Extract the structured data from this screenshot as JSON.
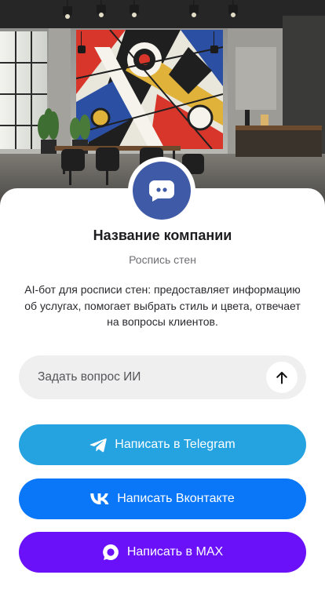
{
  "hero": {
    "icon": "office-mural-photo"
  },
  "profile": {
    "avatar_icon": "chat-bubble-icon",
    "avatar_color": "#3f5aa6",
    "title": "Название компании",
    "subtitle": "Роспись стен",
    "description": "AI-бот для росписи стен: предоставляет информацию об услугах, помогает выбрать стиль и цвета, отвечает на вопросы клиентов."
  },
  "ask": {
    "placeholder": "Задать вопрос ИИ",
    "value": "",
    "send_icon": "arrow-up-icon"
  },
  "buttons": {
    "telegram": {
      "label": "Написать в Telegram",
      "color": "#25a3e1",
      "icon": "telegram-icon"
    },
    "vk": {
      "label": "Написать Вконтакте",
      "color": "#0a77f8",
      "icon": "vk-icon"
    },
    "max": {
      "label": "Написать в MAX",
      "color": "#6a11f9",
      "icon": "max-icon"
    }
  }
}
